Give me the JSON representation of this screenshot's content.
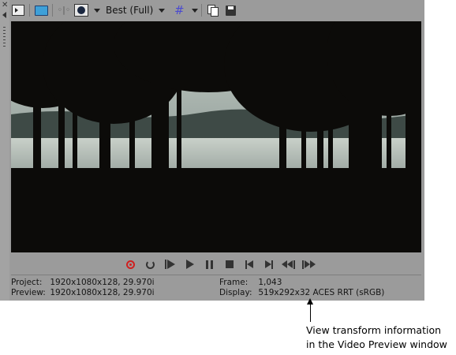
{
  "toolbar": {
    "quality": "Best (Full)",
    "icons": [
      "select-icon",
      "monitor-icon",
      "split-screen-icon",
      "overlay-icon",
      "grid-icon",
      "copy-snapshot-icon",
      "save-snapshot-icon"
    ]
  },
  "transport": {
    "icons": [
      "record-icon",
      "loop-icon",
      "play-from-start-icon",
      "play-icon",
      "pause-icon",
      "stop-icon",
      "prev-frame-icon",
      "next-frame-icon",
      "prev-marker-icon",
      "next-marker-icon"
    ]
  },
  "info": {
    "project_label": "Project:",
    "project_value": "1920x1080x128, 29.970i",
    "preview_label": "Preview:",
    "preview_value": "1920x1080x128, 29.970i",
    "frame_label": "Frame:",
    "frame_value": "1,043",
    "display_label": "Display:",
    "display_value": "519x292x32 ACES RRT (sRGB)"
  },
  "annotation": {
    "line1": "View transform information",
    "line2": "in the Video Preview window"
  },
  "colors": {
    "panel": "#9b9b9b",
    "accent_record": "#d02020",
    "monitor": "#3ea0d8"
  }
}
